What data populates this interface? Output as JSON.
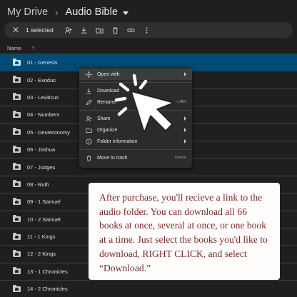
{
  "breadcrumb": {
    "root": "My Drive",
    "separator": "›",
    "current": "Audio Bible"
  },
  "toolbar": {
    "close_icon": "✕",
    "selection_count": "1 selected",
    "icons": [
      "add-person-icon",
      "download-icon",
      "move-to-folder-icon",
      "trash-icon",
      "link-icon",
      "more-vert-icon"
    ]
  },
  "list_header": {
    "name": "Name",
    "sort_icon": "↑"
  },
  "files": [
    {
      "name": "01 - Genesis",
      "selected": true
    },
    {
      "name": "02 - Exodus",
      "selected": false
    },
    {
      "name": "03 - Leviticus",
      "selected": false
    },
    {
      "name": "04 - Numbers",
      "selected": false
    },
    {
      "name": "05 - Deuteronomy",
      "selected": false
    },
    {
      "name": "06 - Joshua",
      "selected": false
    },
    {
      "name": "07 - Judges",
      "selected": false
    },
    {
      "name": "08 - Ruth",
      "selected": false
    },
    {
      "name": "09 - 1 Samuel",
      "selected": false
    },
    {
      "name": "10 - 2 Samuel",
      "selected": false
    },
    {
      "name": "11 - 1 Kings",
      "selected": false
    },
    {
      "name": "12 - 2 Kings",
      "selected": false
    },
    {
      "name": "13 - 1 Chronicles",
      "selected": false
    },
    {
      "name": "14 - 2 Chronicles",
      "selected": false
    }
  ],
  "context_menu": {
    "open_with": "Open with",
    "download": "Download",
    "rename": "Rename",
    "rename_shortcut": "⌥⌘N",
    "share": "Share",
    "organize": "Organize",
    "folder_information": "Folder information",
    "move_to_trash": "Move to trash",
    "trash_shortcut": "Delete"
  },
  "info_card": {
    "text": "After purchase, you'll recieve a link to the audio folder. You can download all 66 books at once, several at once, or one book at a time. Just select the books you'd like to download, RIGHT CLICK, and select “Download.”"
  },
  "colors": {
    "background": "#1f1f1f",
    "selected_row": "#004a77",
    "selected_text": "#c2e7ff",
    "menu_bg": "#2b2b2b",
    "card_text": "#7a2a25"
  }
}
